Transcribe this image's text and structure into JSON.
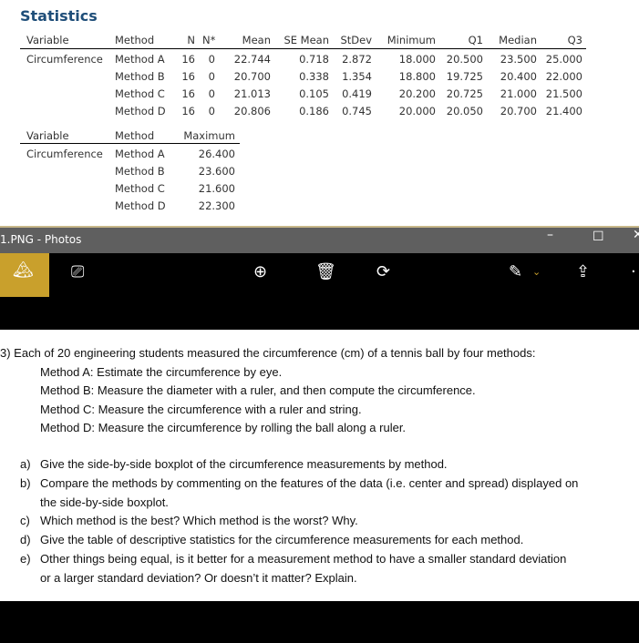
{
  "stats": {
    "title": "Statistics",
    "headers": [
      "Variable",
      "Method",
      "N",
      "N*",
      "Mean",
      "SE Mean",
      "StDev",
      "Minimum",
      "Q1",
      "Median",
      "Q3"
    ],
    "variable": "Circumference",
    "rows": [
      [
        "Method A",
        "16",
        "0",
        "22.744",
        "0.718",
        "2.872",
        "18.000",
        "20.500",
        "23.500",
        "25.000"
      ],
      [
        "Method B",
        "16",
        "0",
        "20.700",
        "0.338",
        "1.354",
        "18.800",
        "19.725",
        "20.400",
        "22.000"
      ],
      [
        "Method C",
        "16",
        "0",
        "21.013",
        "0.105",
        "0.419",
        "20.200",
        "20.725",
        "21.000",
        "21.500"
      ],
      [
        "Method D",
        "16",
        "0",
        "20.806",
        "0.186",
        "0.745",
        "20.000",
        "20.050",
        "20.700",
        "21.400"
      ]
    ],
    "headers2": [
      "Variable",
      "Method",
      "Maximum"
    ],
    "rows2": [
      [
        "Method A",
        "26.400"
      ],
      [
        "Method B",
        "23.600"
      ],
      [
        "Method C",
        "21.600"
      ],
      [
        "Method D",
        "22.300"
      ]
    ]
  },
  "window": {
    "title": "1.PNG - Photos",
    "minimize": "–",
    "maximize": "☐",
    "close": "✕"
  },
  "doc": {
    "lines": [
      "3) Each of 20 engineering students measured the circumference (cm) of a tennis ball by four methods:",
      "Method A:  Estimate the circumference by eye.",
      "Method B:  Measure the diameter with a ruler, and then compute the circumference.",
      "Method C:  Measure the circumference with a ruler and string.",
      "Method D:  Measure the circumference by rolling the ball along a ruler."
    ],
    "questions": [
      [
        "a)",
        "Give the side-by-side boxplot of the circumference measurements by method."
      ],
      [
        "b)",
        "Compare the methods by commenting on the features of the data (i.e. center and spread) displayed on"
      ],
      [
        "",
        "the side-by-side boxplot."
      ],
      [
        "c)",
        "Which method is the best? Which method is the worst? Why."
      ],
      [
        "d)",
        "Give the table of descriptive statistics for the circumference measurements for each method."
      ],
      [
        "e)",
        "Other things being equal, is it better for a measurement method to have a smaller standard deviation"
      ],
      [
        "",
        "or a larger standard deviation? Or doesn’t it matter? Explain."
      ]
    ]
  }
}
